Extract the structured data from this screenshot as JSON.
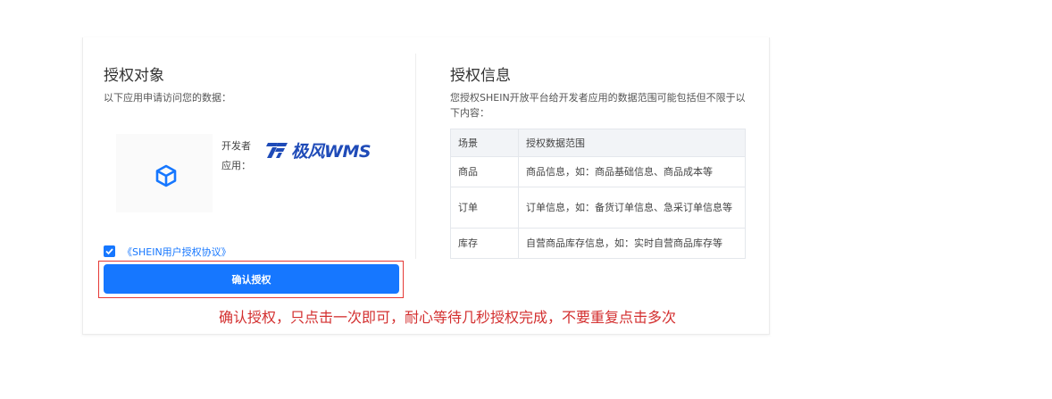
{
  "left": {
    "title": "授权对象",
    "subtitle": "以下应用申请访问您的数据：",
    "developer_label": "开发者",
    "app_label": "应用：",
    "brand_name": "极风WMS",
    "agreement_text": "《SHEIN用户授权协议》",
    "agreement_checked": true,
    "confirm_button": "确认授权"
  },
  "right": {
    "title": "授权信息",
    "desc": "您授权SHEIN开放平台给开发者应用的数据范围可能包括但不限于以下内容：",
    "table": {
      "headers": [
        "场景",
        "授权数据范围"
      ],
      "rows": [
        [
          "商品",
          "商品信息，如：商品基础信息、商品成本等"
        ],
        [
          "订单",
          "订单信息，如：备货订单信息、急采订单信息等"
        ],
        [
          "库存",
          "自营商品库存信息，如：实时自营商品库存等"
        ]
      ]
    }
  },
  "annotation": {
    "note": "确认授权，只点击一次即可，耐心等待几秒授权完成，不要重复点击多次",
    "color": "#d32f2f"
  },
  "colors": {
    "primary": "#1677ff",
    "brand": "#1f4bb8",
    "highlight": "#e53935"
  }
}
